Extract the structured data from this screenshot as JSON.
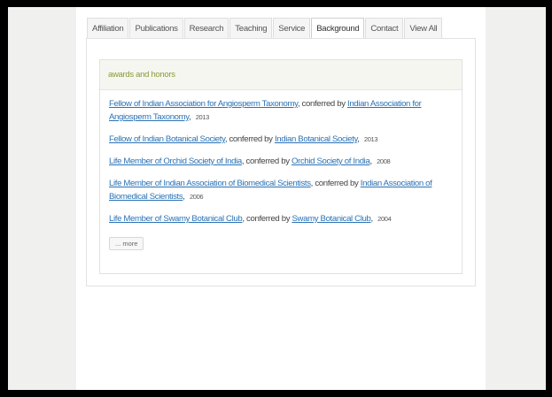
{
  "tabs": [
    "Affiliation",
    "Publications",
    "Research",
    "Teaching",
    "Service",
    "Background",
    "Contact",
    "View All"
  ],
  "active_tab": "Background",
  "section": {
    "title": "awards and honors",
    "items": [
      {
        "award": "Fellow of Indian Association for Angiosperm Taxonomy",
        "conferred": "conferred by",
        "org": "Indian Association for Angiosperm Taxonomy",
        "year": "2013"
      },
      {
        "award": "Fellow of Indian Botanical Society",
        "conferred": "conferred by",
        "org": "Indian Botanical Society",
        "year": "2013"
      },
      {
        "award": "Life Member of Orchid Society of India",
        "conferred": "conferred by",
        "org": "Orchid Society of India",
        "year": "2008"
      },
      {
        "award": "Life Member of Indian Association of Biomedical Scientists",
        "conferred": "conferred by",
        "org": "Indian Association of Biomedical Scientists",
        "year": "2006"
      },
      {
        "award": "Life Member of Swamy Botanical Club",
        "conferred": "conferred by",
        "org": "Swamy Botanical Club",
        "year": "2004"
      }
    ],
    "more_label": "... more"
  },
  "colors": {
    "link": "#2a72b5",
    "header_text": "#8a9a36",
    "sidebar_bg": "#f0f1ee"
  }
}
